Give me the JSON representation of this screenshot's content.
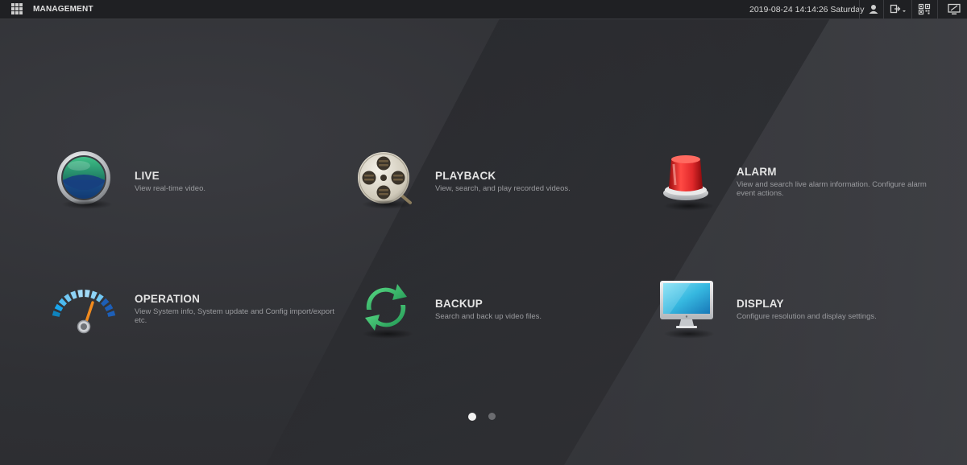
{
  "topbar": {
    "title": "MANAGEMENT",
    "datetime": "2019-08-24 14:14:26 Saturday",
    "icons": [
      "grid-menu-icon",
      "user-icon",
      "logout-icon",
      "qr-code-icon",
      "display-settings-icon"
    ]
  },
  "tiles": [
    {
      "id": "live",
      "name": "LIVE",
      "desc": "View real-time video.",
      "icon": "live-icon"
    },
    {
      "id": "playback",
      "name": "PLAYBACK",
      "desc": "View, search, and play recorded videos.",
      "icon": "film-reel-icon"
    },
    {
      "id": "alarm",
      "name": "ALARM",
      "desc": "View and search live alarm information. Configure alarm event actions.",
      "icon": "alarm-siren-icon"
    },
    {
      "id": "operation",
      "name": "OPERATION",
      "desc": "View System info, System update and Config import/export etc.",
      "icon": "gauge-icon"
    },
    {
      "id": "backup",
      "name": "BACKUP",
      "desc": "Search and back up video files.",
      "icon": "refresh-arrows-icon"
    },
    {
      "id": "display",
      "name": "DISPLAY",
      "desc": "Configure resolution and display settings.",
      "icon": "monitor-icon"
    }
  ],
  "pagination": {
    "pages": 2,
    "current": 1
  },
  "colors": {
    "accent_green": "#2fb36a",
    "alarm_red": "#e0282a",
    "gauge_blue": "#2aa0e8",
    "monitor_cyan": "#36b8e0"
  }
}
